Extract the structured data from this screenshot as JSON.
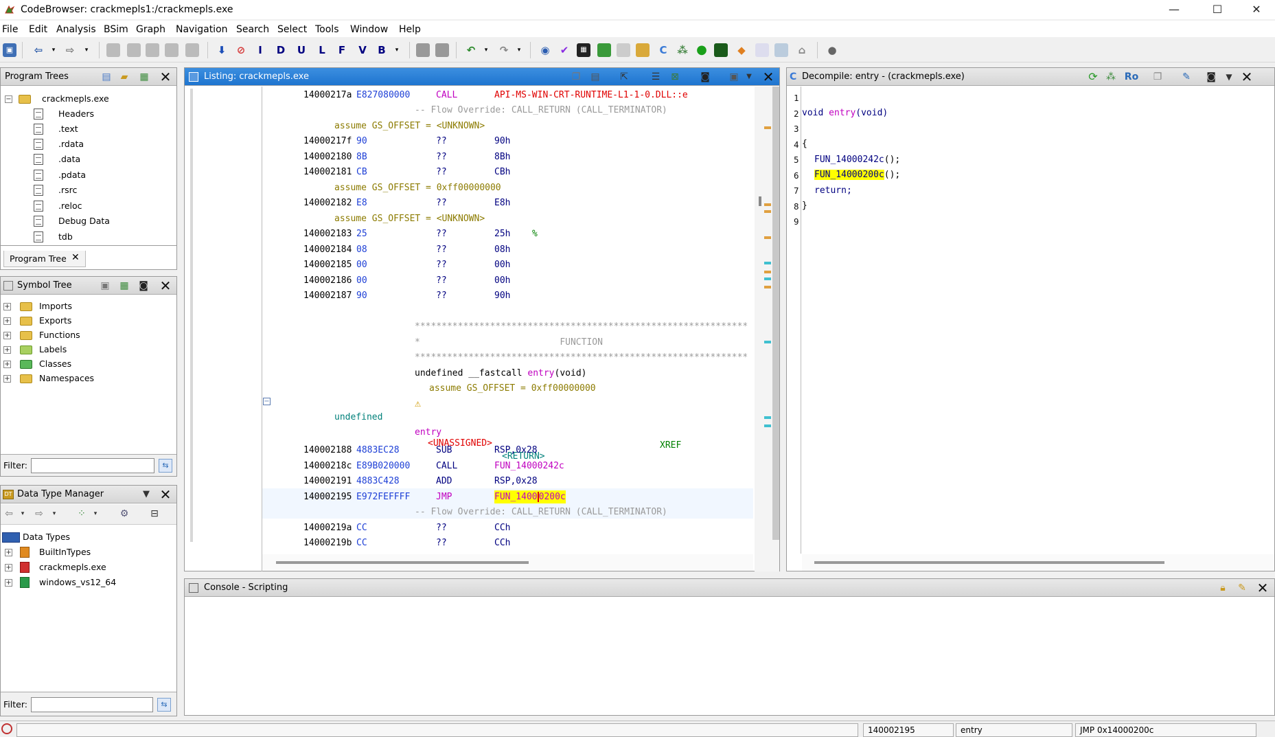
{
  "window": {
    "title": "CodeBrowser: crackmepls1:/crackmepls.exe",
    "minimize": "—",
    "maximize": "☐",
    "close": "✕"
  },
  "menu": [
    "File",
    "Edit",
    "Analysis",
    "BSim",
    "Graph",
    "Navigation",
    "Search",
    "Select",
    "Tools",
    "Window",
    "Help"
  ],
  "toolbar": {
    "letters": [
      "I",
      "D",
      "U",
      "L",
      "F",
      "V",
      "B"
    ]
  },
  "program_trees": {
    "title": "Program Trees",
    "root": "crackmepls.exe",
    "items": [
      "Headers",
      ".text",
      ".rdata",
      ".data",
      ".pdata",
      ".rsrc",
      ".reloc",
      "Debug Data",
      "tdb"
    ],
    "tab": "Program Tree"
  },
  "symbol_tree": {
    "title": "Symbol Tree",
    "items": [
      "Imports",
      "Exports",
      "Functions",
      "Labels",
      "Classes",
      "Namespaces"
    ],
    "filter_label": "Filter:"
  },
  "data_type_manager": {
    "title": "Data Type Manager",
    "root": "Data Types",
    "items": [
      "BuiltInTypes",
      "crackmepls.exe",
      "windows_vs12_64"
    ],
    "filter_label": "Filter:"
  },
  "listing": {
    "title": "Listing:  crackmepls.exe",
    "lines": {
      "l1": {
        "addr": "14000217a",
        "bytes": "E827080000",
        "mnem": "CALL",
        "op": "API-MS-WIN-CRT-RUNTIME-L1-1-0.DLL::e"
      },
      "l2": {
        "text": "-- Flow Override: CALL_RETURN (CALL_TERMINATOR)"
      },
      "l3": {
        "text": "assume GS_OFFSET = <UNKNOWN>"
      },
      "l4": {
        "addr": "14000217f",
        "bytes": "90",
        "mnem": "??",
        "op": "90h"
      },
      "l5": {
        "addr": "140002180",
        "bytes": "8B",
        "mnem": "??",
        "op": "8Bh"
      },
      "l6": {
        "addr": "140002181",
        "bytes": "CB",
        "mnem": "??",
        "op": "CBh"
      },
      "l7": {
        "text": "assume GS_OFFSET = 0xff00000000"
      },
      "l8": {
        "addr": "140002182",
        "bytes": "E8",
        "mnem": "??",
        "op": "E8h"
      },
      "l9": {
        "text": "assume GS_OFFSET = <UNKNOWN>"
      },
      "l10": {
        "addr": "140002183",
        "bytes": "25",
        "mnem": "??",
        "op": "25h",
        "cmt": "%"
      },
      "l11": {
        "addr": "140002184",
        "bytes": "08",
        "mnem": "??",
        "op": "08h"
      },
      "l12": {
        "addr": "140002185",
        "bytes": "00",
        "mnem": "??",
        "op": "00h"
      },
      "l13": {
        "addr": "140002186",
        "bytes": "00",
        "mnem": "??",
        "op": "00h"
      },
      "l14": {
        "addr": "140002187",
        "bytes": "90",
        "mnem": "??",
        "op": "90h"
      },
      "stars": "**************************************************************",
      "func_header": "*                          FUNCTION",
      "sig_pre": "undefined __fastcall ",
      "sig_name": "entry",
      "sig_post": "(void)",
      "assume_fn": "assume GS_OFFSET = 0xff00000000",
      "ret_type": "undefined",
      "unassigned": "<UNASSIGNED>",
      "ret": "<RETURN>",
      "label": "entry",
      "xref": "XREF",
      "l20": {
        "addr": "140002188",
        "bytes": "4883EC28",
        "mnem": "SUB",
        "op": "RSP,0x28"
      },
      "l21": {
        "addr": "14000218c",
        "bytes": "E89B020000",
        "mnem": "CALL",
        "op": "FUN_14000242c"
      },
      "l22": {
        "addr": "140002191",
        "bytes": "4883C428",
        "mnem": "ADD",
        "op": "RSP,0x28"
      },
      "l23": {
        "addr": "140002195",
        "bytes": "E972FEFFFF",
        "mnem": "JMP",
        "op_a": "FUN_1400",
        "op_b": "0200c"
      },
      "l24": {
        "text": "-- Flow Override: CALL_RETURN (CALL_TERMINATOR)"
      },
      "l25": {
        "addr": "14000219a",
        "bytes": "CC",
        "mnem": "??",
        "op": "CCh"
      },
      "l26": {
        "addr": "14000219b",
        "bytes": "CC",
        "mnem": "??",
        "op": "CCh"
      }
    }
  },
  "decompile": {
    "title": "Decompile: entry -  (crackmepls.exe)",
    "ro": "Ro",
    "line_numbers": [
      "1",
      "2",
      "3",
      "4",
      "5",
      "6",
      "7",
      "8",
      "9"
    ],
    "code": {
      "sig_type": "void ",
      "sig_name": "entry",
      "sig_args": "(void)",
      "open": "{",
      "call1": "FUN_14000242c",
      "call1_tail": "();",
      "call2": "FUN_14000200c",
      "call2_tail": "();",
      "ret": "return;",
      "close": "}"
    }
  },
  "console": {
    "title": "Console - Scripting"
  },
  "status": {
    "address": "140002195",
    "function": "entry",
    "instruction": "JMP 0x14000200c"
  },
  "colors": {
    "active_header": "#1e74cf",
    "highlight": "#ffff00",
    "address_blue": "#1d3fd6",
    "label_magenta": "#c000c0"
  }
}
